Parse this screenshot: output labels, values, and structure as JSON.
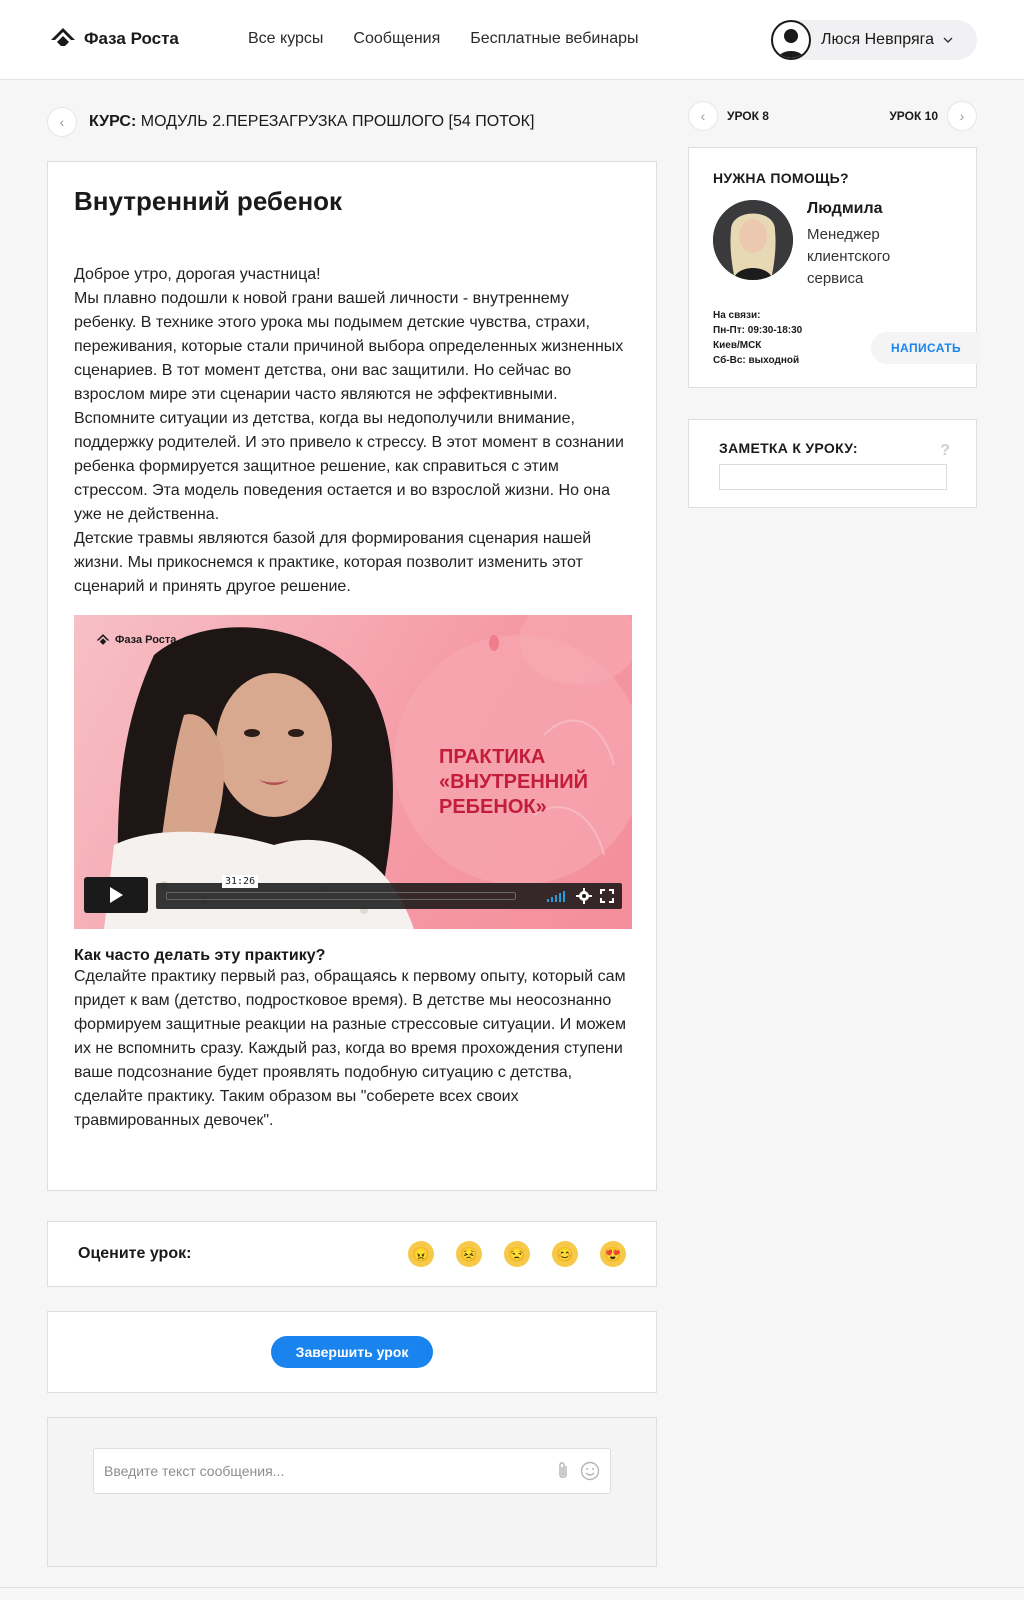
{
  "brand": {
    "name": "Фаза Роста"
  },
  "nav": {
    "items": [
      "Все курсы",
      "Сообщения",
      "Бесплатные вебинары"
    ]
  },
  "user": {
    "name": "Люся Невпряга"
  },
  "breadcrumb": {
    "prefix": "КУРС:",
    "course": "МОДУЛЬ 2.ПЕРЕЗАГРУЗКА ПРОШЛОГО [54 ПОТОК]"
  },
  "lesson": {
    "title": "Внутренний ребенок",
    "paragraphs": [
      "Доброе утро, дорогая участница!",
      "Мы плавно подошли к новой грани вашей личности - внутреннему ребенку. В технике этого урока мы подымем детские чувства, страхи, переживания, которые стали причиной выбора определенных жизненных сценариев. В тот момент детства, они вас защитили. Но сейчас во взрослом мире эти сценарии часто являются не эффективными.",
      "Вспомните ситуации из детства, когда вы недополучили внимание, поддержку родителей. И это привело к стрессу. В этот момент в сознании ребенка формируется защитное решение, как справиться с этим стрессом. Эта модель поведения остается и во взрослой жизни. Но она уже не действенна.",
      "Детские травмы являются базой для формирования сценария нашей жизни. Мы прикоснемся к практике, которая позволит изменить этот сценарий и принять другое решение."
    ],
    "video": {
      "brand": "Фаза Роста",
      "title_lines": [
        "ПРАКТИКА",
        "«ВНУТРЕННИЙ",
        "РЕБЕНОК»"
      ],
      "duration": "31:26"
    },
    "practice_heading": "Как часто делать эту практику?",
    "practice_text": "Сделайте практику первый раз, обращаясь к первому опыту, который сам придет к вам (детство, подростковое время). В детстве мы неосознанно формируем защитные реакции на разные стрессовые ситуации. И можем их не вспомнить сразу. Каждый раз, когда во время прохождения ступени ваше подсознание будет проявлять подобную ситуацию с детства, сделайте практику. Таким образом вы \"соберете всех своих травмированных девочек\"."
  },
  "rating": {
    "label": "Оцените урок:",
    "emojis": [
      "😠",
      "😣",
      "😒",
      "😊",
      "😍"
    ]
  },
  "complete": {
    "label": "Завершить урок"
  },
  "message": {
    "placeholder": "Введите текст сообщения..."
  },
  "lesson_nav": {
    "prev": "УРОК 8",
    "next": "УРОК 10"
  },
  "help": {
    "title": "НУЖНА ПОМОЩЬ?",
    "manager_name": "Людмила",
    "manager_role": "Менеджер клиентского сервиса",
    "hours": [
      "На связи:",
      "Пн-Пт: 09:30-18:30",
      "Киев/МСК",
      "Сб-Вс: выходной"
    ],
    "write_label": "НАПИСАТЬ"
  },
  "note": {
    "title": "ЗАМЕТКА К УРОКУ:",
    "help_icon": "?"
  },
  "colors": {
    "accent": "#1a84ee",
    "video_title": "#c21e3a",
    "video_bg": "#f59aa5"
  }
}
